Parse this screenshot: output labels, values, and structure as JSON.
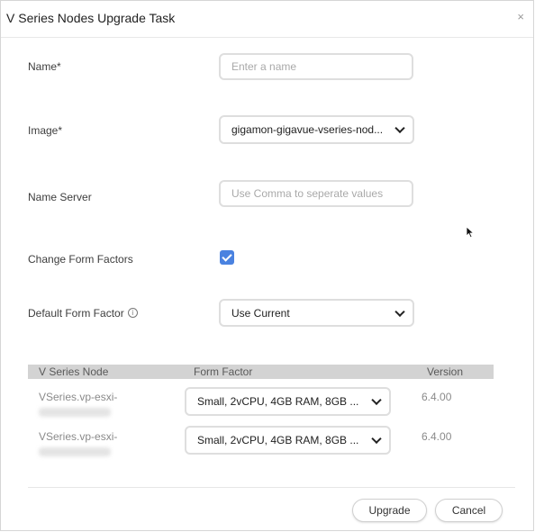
{
  "dialog": {
    "title": "V Series Nodes Upgrade Task",
    "close_glyph": "×"
  },
  "form": {
    "name": {
      "label": "Name*",
      "placeholder": "Enter a name",
      "value": ""
    },
    "image": {
      "label": "Image*",
      "selected": "gigamon-gigavue-vseries-nod..."
    },
    "name_server": {
      "label": "Name Server",
      "placeholder": "Use Comma to seperate values",
      "value": ""
    },
    "change_form_factors": {
      "label": "Change Form Factors",
      "checked": true
    },
    "default_form_factor": {
      "label": "Default Form Factor",
      "info_glyph": "i",
      "selected": "Use Current"
    }
  },
  "table": {
    "columns": [
      "V Series Node",
      "Form Factor",
      "Version"
    ],
    "rows": [
      {
        "node": "VSeries.vp-esxi-",
        "form_factor": "Small, 2vCPU, 4GB RAM, 8GB ...",
        "version": "6.4.00"
      },
      {
        "node": "VSeries.vp-esxi-",
        "form_factor": "Small, 2vCPU, 4GB RAM, 8GB ...",
        "version": "6.4.00"
      }
    ]
  },
  "footer": {
    "upgrade_label": "Upgrade",
    "cancel_label": "Cancel"
  },
  "colors": {
    "accent": "#4a82e0",
    "table_header_bg": "#d3d3d3",
    "border": "#dedede"
  }
}
